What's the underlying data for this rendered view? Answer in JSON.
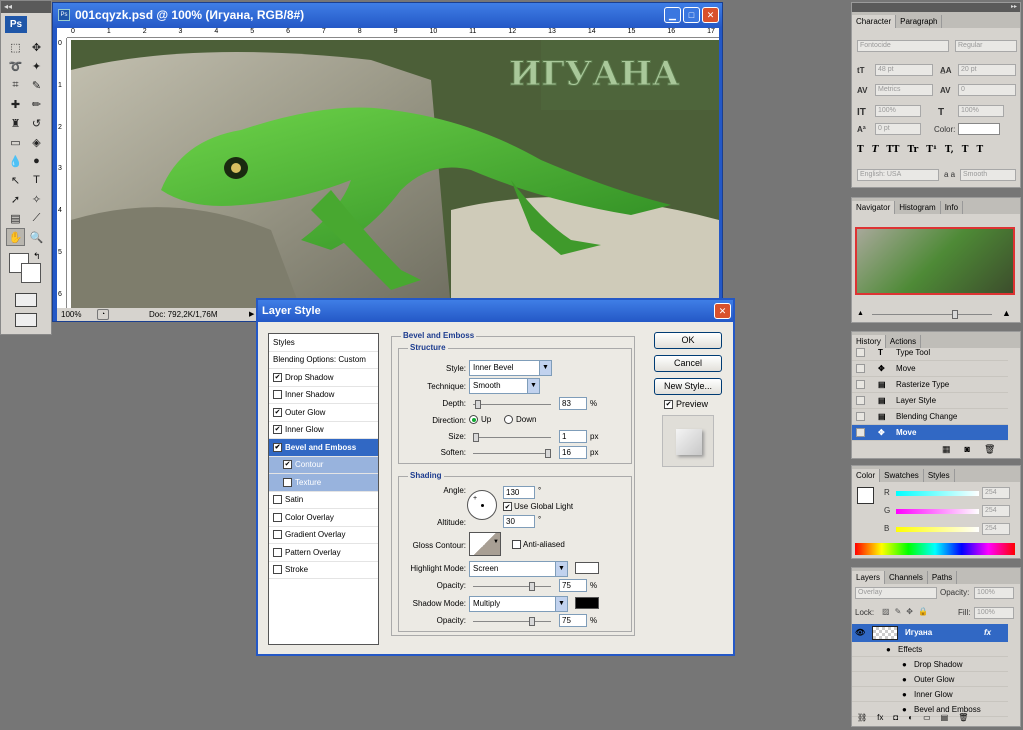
{
  "document": {
    "title": "001cqyzk.psd @ 100% (Игуана, RGB/8#)",
    "artwork_text": "ИГУАНА",
    "zoom": "100%",
    "doc_size": "Doc: 792,2K/1,76M",
    "ruler_h": [
      "0",
      "1",
      "2",
      "3",
      "4",
      "5",
      "6",
      "7",
      "8",
      "9",
      "10",
      "11",
      "12",
      "13",
      "14",
      "15",
      "16",
      "17"
    ],
    "ruler_v": [
      "0",
      "1",
      "2",
      "3",
      "4",
      "5",
      "6"
    ]
  },
  "toolbox": {
    "logo": "Ps"
  },
  "dialog": {
    "title": "Layer Style",
    "styles_header": "Styles",
    "blending": "Blending Options: Custom",
    "items": [
      {
        "label": "Drop Shadow",
        "checked": true
      },
      {
        "label": "Inner Shadow",
        "checked": false
      },
      {
        "label": "Outer Glow",
        "checked": true
      },
      {
        "label": "Inner Glow",
        "checked": true
      },
      {
        "label": "Bevel and Emboss",
        "checked": true
      },
      {
        "label": "Contour",
        "checked": true
      },
      {
        "label": "Texture",
        "checked": false
      },
      {
        "label": "Satin",
        "checked": false
      },
      {
        "label": "Color Overlay",
        "checked": false
      },
      {
        "label": "Gradient Overlay",
        "checked": false
      },
      {
        "label": "Pattern Overlay",
        "checked": false
      },
      {
        "label": "Stroke",
        "checked": false
      }
    ],
    "section_title": "Bevel and Emboss",
    "structure": {
      "legend": "Structure",
      "style_label": "Style:",
      "style_value": "Inner Bevel",
      "technique_label": "Technique:",
      "technique_value": "Smooth",
      "depth_label": "Depth:",
      "depth_value": "83",
      "depth_unit": "%",
      "direction_label": "Direction:",
      "dir_up": "Up",
      "dir_down": "Down",
      "size_label": "Size:",
      "size_value": "1",
      "size_unit": "px",
      "soften_label": "Soften:",
      "soften_value": "16",
      "soften_unit": "px"
    },
    "shading": {
      "legend": "Shading",
      "angle_label": "Angle:",
      "angle_value": "130",
      "angle_unit": "°",
      "global_light": "Use Global Light",
      "altitude_label": "Altitude:",
      "altitude_value": "30",
      "altitude_unit": "°",
      "gloss_label": "Gloss Contour:",
      "anti_aliased": "Anti-aliased",
      "highlight_label": "Highlight Mode:",
      "highlight_value": "Screen",
      "h_opacity_label": "Opacity:",
      "h_opacity_value": "75",
      "h_opacity_unit": "%",
      "shadow_label": "Shadow Mode:",
      "shadow_value": "Multiply",
      "s_opacity_label": "Opacity:",
      "s_opacity_value": "75",
      "s_opacity_unit": "%"
    },
    "buttons": {
      "ok": "OK",
      "cancel": "Cancel",
      "new_style": "New Style...",
      "preview": "Preview"
    }
  },
  "character": {
    "tabs": [
      "Character",
      "Paragraph"
    ],
    "font": "Fontocide",
    "style": "Regular",
    "size": "48 pt",
    "leading": "20 pt",
    "kerning": "Metrics",
    "tracking": "0",
    "vscale": "100%",
    "hscale": "100%",
    "baseline": "0 pt",
    "color_label": "Color:",
    "type_buttons": [
      "T",
      "T",
      "TT",
      "Tr",
      "T¹",
      "T,",
      "T",
      "T"
    ],
    "language": "English: USA",
    "aa_label": "a a",
    "aa": "Smooth"
  },
  "navigator": {
    "tabs": [
      "Navigator",
      "Histogram",
      "Info"
    ]
  },
  "history": {
    "tabs": [
      "History",
      "Actions"
    ],
    "items": [
      "Type Tool",
      "Move",
      "Rasterize Type",
      "Layer Style",
      "Blending Change",
      "Move"
    ]
  },
  "color": {
    "tabs": [
      "Color",
      "Swatches",
      "Styles"
    ],
    "r": "254",
    "g": "254",
    "b": "254",
    "r_label": "R",
    "g_label": "G",
    "b_label": "B"
  },
  "layers": {
    "tabs": [
      "Layers",
      "Channels",
      "Paths"
    ],
    "blend": "Overlay",
    "opacity_label": "Opacity:",
    "opacity": "100%",
    "lock_label": "Lock:",
    "fill_label": "Fill:",
    "fill": "100%",
    "layer_name": "Игуана",
    "effects_label": "Effects",
    "effects": [
      "Drop Shadow",
      "Outer Glow",
      "Inner Glow",
      "Bevel and Emboss"
    ]
  }
}
